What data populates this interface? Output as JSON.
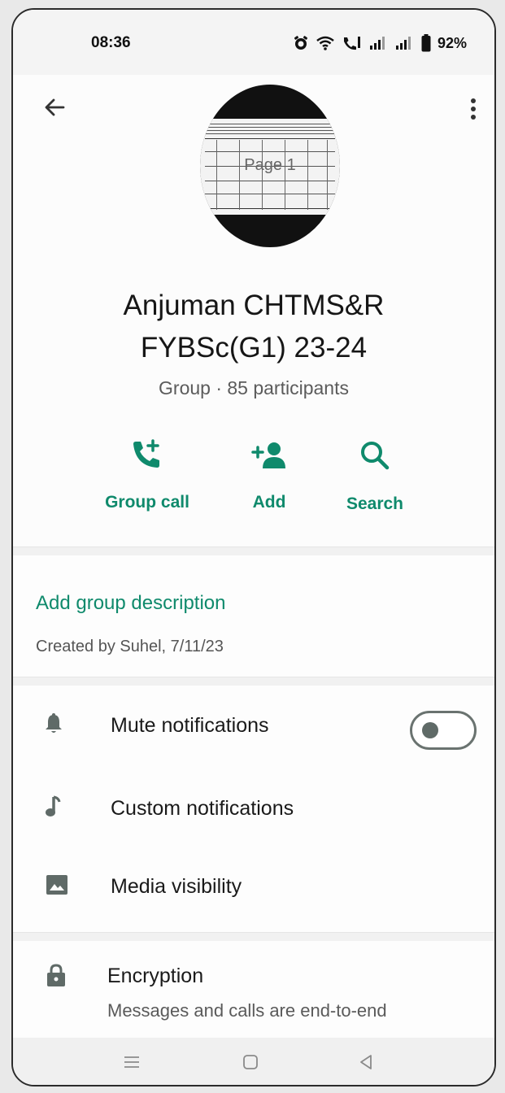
{
  "status_bar": {
    "time": "08:36",
    "battery": "92%",
    "icons": [
      "alarm-icon",
      "wifi-icon",
      "volte-call-icon",
      "signal-icon",
      "signal-icon",
      "battery-icon"
    ]
  },
  "header": {
    "back_icon": "arrow-left-icon",
    "more_icon": "more-vertical-icon",
    "avatar_label": "Page 1",
    "group_name_line1": "Anjuman CHTMS&R",
    "group_name_line2": "FYBSc(G1) 23-24",
    "subtitle": "Group · 85 participants"
  },
  "actions": [
    {
      "label": "Group call",
      "icon": "add-call-icon"
    },
    {
      "label": "Add",
      "icon": "add-person-icon"
    },
    {
      "label": "Search",
      "icon": "search-icon"
    }
  ],
  "description": {
    "add_label": "Add group description",
    "created_by": "Created by Suhel, 7/11/23"
  },
  "settings": {
    "mute": {
      "label": "Mute notifications",
      "icon": "bell-icon",
      "enabled": false
    },
    "custom": {
      "label": "Custom notifications",
      "icon": "music-note-icon"
    },
    "media": {
      "label": "Media visibility",
      "icon": "image-icon"
    }
  },
  "encryption": {
    "label": "Encryption",
    "description": "Messages and calls are end-to-end",
    "icon": "lock-icon"
  },
  "navigation": {
    "icons": [
      "menu-icon",
      "home-icon",
      "back-icon"
    ]
  },
  "colors": {
    "accent": "#0f8a6c",
    "background": "#fdfdfd",
    "text_primary": "#1a1a1a",
    "text_secondary": "#5b5b5b"
  }
}
